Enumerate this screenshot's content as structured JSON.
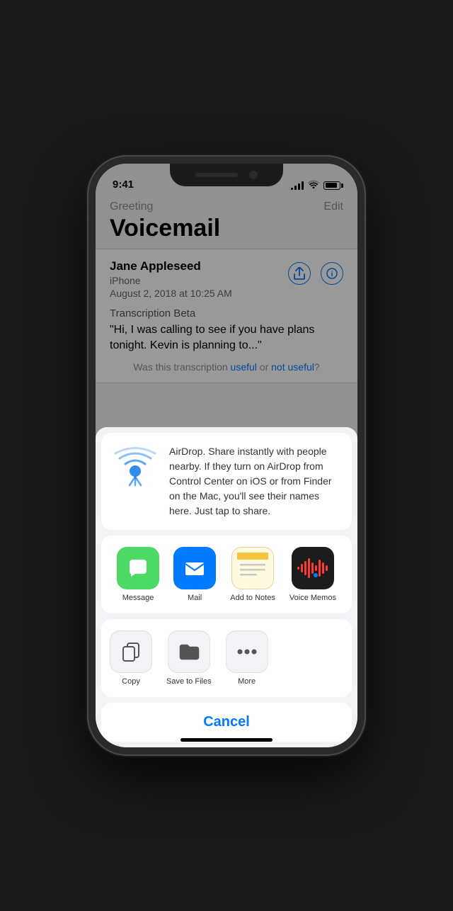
{
  "status": {
    "time": "9:41",
    "signal_bars": [
      3,
      6,
      9,
      12
    ],
    "battery_percent": 85
  },
  "app": {
    "greeting_label": "Greeting",
    "edit_label": "Edit",
    "title": "Voicemail"
  },
  "voicemail": {
    "caller_name": "Jane Appleseed",
    "caller_source": "iPhone",
    "call_datetime": "August 2, 2018 at 10:25 AM",
    "transcription_label": "Transcription Beta",
    "transcription_text": "\"Hi, I was calling to see if you have plans tonight. Kevin is planning to...\"",
    "feedback_prefix": "Was this transcription ",
    "feedback_useful": "useful",
    "feedback_or": " or ",
    "feedback_not_useful": "not useful",
    "feedback_suffix": "?"
  },
  "share_sheet": {
    "airdrop_title": "AirDrop",
    "airdrop_description": "AirDrop. Share instantly with people nearby. If they turn on AirDrop from Control Center on iOS or from Finder on the Mac, you'll see their names here. Just tap to share.",
    "apps": [
      {
        "id": "messages",
        "label": "Message"
      },
      {
        "id": "mail",
        "label": "Mail"
      },
      {
        "id": "notes",
        "label": "Add to Notes"
      },
      {
        "id": "voice-memos",
        "label": "Voice Memos"
      }
    ],
    "actions": [
      {
        "id": "copy",
        "label": "Copy"
      },
      {
        "id": "save-to-files",
        "label": "Save to Files"
      },
      {
        "id": "more",
        "label": "More"
      }
    ],
    "cancel_label": "Cancel"
  }
}
